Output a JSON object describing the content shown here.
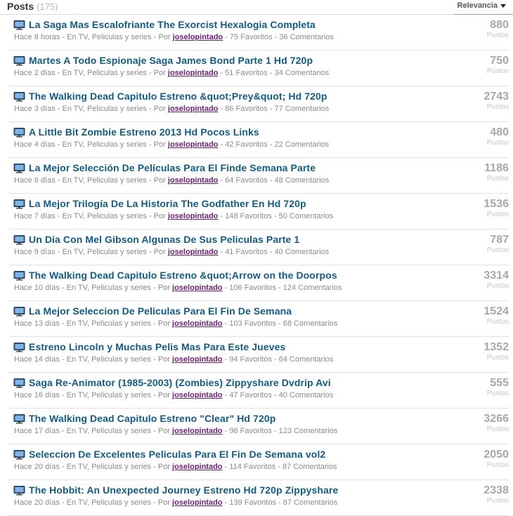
{
  "header": {
    "title": "Posts",
    "count": "(175)",
    "sort_label": "Relevancia"
  },
  "meta_common": {
    "category": "En TV, Peliculas y series",
    "por": "Por",
    "fav_suffix": "Favoritos",
    "com_suffix": "Comentarios",
    "points_unit": "Puntos"
  },
  "posts": [
    {
      "title": "La Saga Mas Escalofriante The Exorcist Hexalogia Completa",
      "time": "Hace 8 horas",
      "author": "joselopintado",
      "favs": "75",
      "comments": "36",
      "points": "880"
    },
    {
      "title": "Martes A Todo Espionaje Saga James Bond Parte 1 Hd 720p",
      "time": "Hace 2 días",
      "author": "joselopintado",
      "favs": "51",
      "comments": "34",
      "points": "750"
    },
    {
      "title": "The Walking Dead Capitulo Estreno &quot;Prey&quot; Hd 720p",
      "time": "Hace 3 días",
      "author": "joselopintado",
      "favs": "86",
      "comments": "77",
      "points": "2743"
    },
    {
      "title": "A Little Bit Zombie Estreno 2013 Hd Pocos Links",
      "time": "Hace 4 días",
      "author": "joselopintado",
      "favs": "42",
      "comments": "22",
      "points": "480"
    },
    {
      "title": "La Mejor Selección De Películas Para El Finde Semana Parte",
      "time": "Hace 6 días",
      "author": "joselopintado",
      "favs": "64",
      "comments": "48",
      "points": "1186"
    },
    {
      "title": "La Mejor Trilogía De La Historia The Godfather En Hd 720p",
      "time": "Hace 7 días",
      "author": "joselopintado",
      "favs": "148",
      "comments": "50",
      "points": "1536"
    },
    {
      "title": "Un Dia Con Mel Gibson Algunas De Sus Peliculas Parte 1",
      "time": "Hace 9 días",
      "author": "joselopintado",
      "favs": "41",
      "comments": "40",
      "points": "787"
    },
    {
      "title": "The Walking Dead Capitulo Estreno &quot;Arrow on the Doorpos",
      "time": "Hace 10 días",
      "author": "joselopintado",
      "favs": "106",
      "comments": "124",
      "points": "3314"
    },
    {
      "title": "La Mejor Seleccion De Peliculas Para El Fin De Semana",
      "time": "Hace 13 días",
      "author": "joselopintado",
      "favs": "103",
      "comments": "68",
      "points": "1524"
    },
    {
      "title": "Estreno Lincoln y Muchas Pelis Mas Para Este Jueves",
      "time": "Hace 14 días",
      "author": "joselopintado",
      "favs": "94",
      "comments": "64",
      "points": "1352"
    },
    {
      "title": "Saga Re-Animator (1985-2003) (Zombies) Zippyshare Dvdrip Avi",
      "time": "Hace 16 días",
      "author": "joselopintado",
      "favs": "47",
      "comments": "40",
      "points": "555"
    },
    {
      "title": "The Walking Dead Capitulo Estreno \"Clear\" Hd 720p",
      "time": "Hace 17 días",
      "author": "joselopintado",
      "favs": "98",
      "comments": "123",
      "points": "3266"
    },
    {
      "title": "Seleccion De Excelentes Peliculas Para El Fin De Semana vol2",
      "time": "Hace 20 días",
      "author": "joselopintado",
      "favs": "114",
      "comments": "87",
      "points": "2050"
    },
    {
      "title": "The Hobbit: An Unexpected Journey Estreno Hd 720p Zippyshare",
      "time": "Hace 20 días",
      "author": "joselopintado",
      "favs": "139",
      "comments": "87",
      "points": "2338"
    }
  ],
  "icon": "tv-monitor-icon",
  "colors": {
    "title": "#0f5b8a",
    "author": "#6e1f7a",
    "meta": "#8a8a8a",
    "points": "#a8a8a8"
  }
}
